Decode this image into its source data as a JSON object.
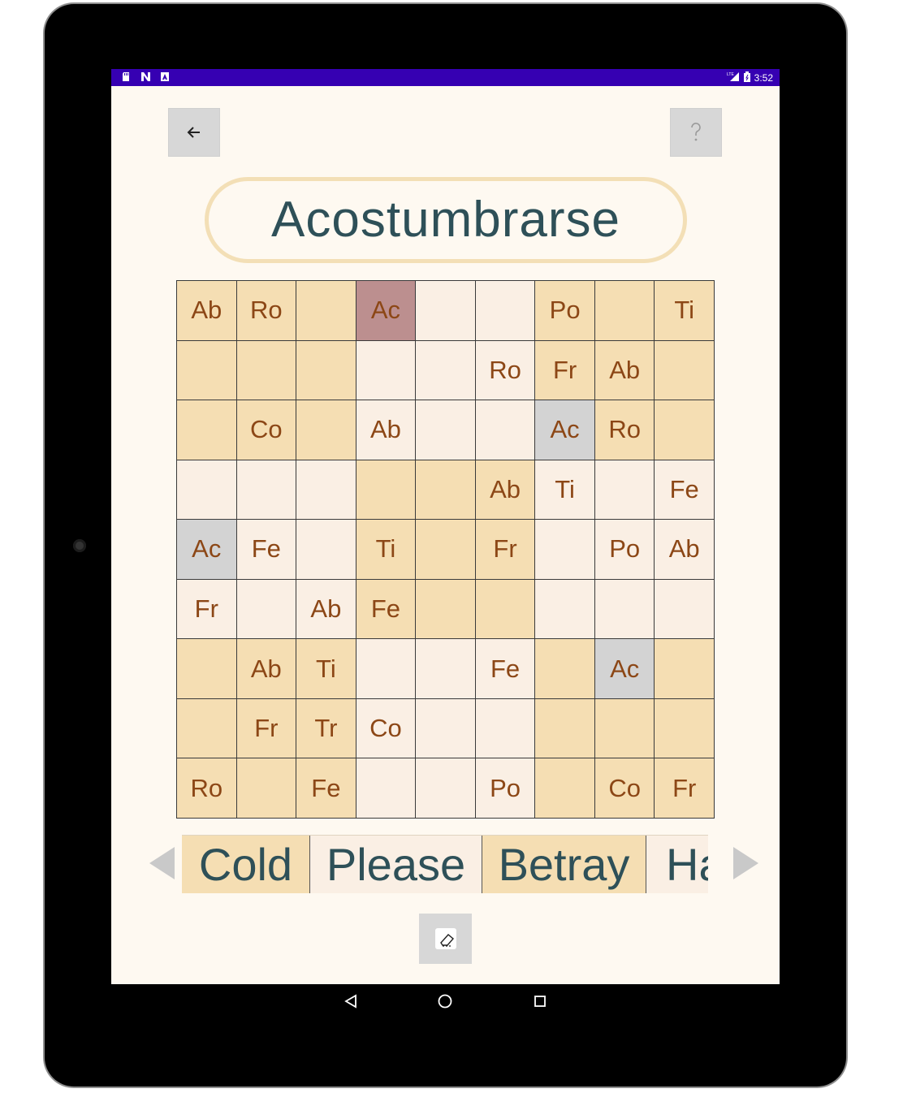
{
  "status_bar": {
    "time": "3:52",
    "signal_label": "LTE"
  },
  "header": {
    "back_icon": "arrow-left-icon",
    "help_icon": "question-mark-icon"
  },
  "target_word": "Acostumbrarse",
  "grid": {
    "rows": [
      [
        {
          "text": "Ab",
          "state": "t"
        },
        {
          "text": "Ro",
          "state": "t"
        },
        {
          "text": "",
          "state": "t"
        },
        {
          "text": "Ac",
          "state": "r"
        },
        {
          "text": "",
          "state": "l"
        },
        {
          "text": "",
          "state": "l"
        },
        {
          "text": "Po",
          "state": "t"
        },
        {
          "text": "",
          "state": "t"
        },
        {
          "text": "Ti",
          "state": "t"
        }
      ],
      [
        {
          "text": "",
          "state": "t"
        },
        {
          "text": "",
          "state": "t"
        },
        {
          "text": "",
          "state": "t"
        },
        {
          "text": "",
          "state": "l"
        },
        {
          "text": "",
          "state": "l"
        },
        {
          "text": "Ro",
          "state": "l"
        },
        {
          "text": "Fr",
          "state": "t"
        },
        {
          "text": "Ab",
          "state": "t"
        },
        {
          "text": "",
          "state": "t"
        }
      ],
      [
        {
          "text": "",
          "state": "t"
        },
        {
          "text": "Co",
          "state": "t"
        },
        {
          "text": "",
          "state": "t"
        },
        {
          "text": "Ab",
          "state": "l"
        },
        {
          "text": "",
          "state": "l"
        },
        {
          "text": "",
          "state": "l"
        },
        {
          "text": "Ac",
          "state": "g"
        },
        {
          "text": "Ro",
          "state": "t"
        },
        {
          "text": "",
          "state": "t"
        }
      ],
      [
        {
          "text": "",
          "state": "l"
        },
        {
          "text": "",
          "state": "l"
        },
        {
          "text": "",
          "state": "l"
        },
        {
          "text": "",
          "state": "t"
        },
        {
          "text": "",
          "state": "t"
        },
        {
          "text": "Ab",
          "state": "t"
        },
        {
          "text": "Ti",
          "state": "l"
        },
        {
          "text": "",
          "state": "l"
        },
        {
          "text": "Fe",
          "state": "l"
        }
      ],
      [
        {
          "text": "Ac",
          "state": "g"
        },
        {
          "text": "Fe",
          "state": "l"
        },
        {
          "text": "",
          "state": "l"
        },
        {
          "text": "Ti",
          "state": "t"
        },
        {
          "text": "",
          "state": "t"
        },
        {
          "text": "Fr",
          "state": "t"
        },
        {
          "text": "",
          "state": "l"
        },
        {
          "text": "Po",
          "state": "l"
        },
        {
          "text": "Ab",
          "state": "l"
        }
      ],
      [
        {
          "text": "Fr",
          "state": "l"
        },
        {
          "text": "",
          "state": "l"
        },
        {
          "text": "Ab",
          "state": "l"
        },
        {
          "text": "Fe",
          "state": "t"
        },
        {
          "text": "",
          "state": "t"
        },
        {
          "text": "",
          "state": "t"
        },
        {
          "text": "",
          "state": "l"
        },
        {
          "text": "",
          "state": "l"
        },
        {
          "text": "",
          "state": "l"
        }
      ],
      [
        {
          "text": "",
          "state": "t"
        },
        {
          "text": "Ab",
          "state": "t"
        },
        {
          "text": "Ti",
          "state": "t"
        },
        {
          "text": "",
          "state": "l"
        },
        {
          "text": "",
          "state": "l"
        },
        {
          "text": "Fe",
          "state": "l"
        },
        {
          "text": "",
          "state": "t"
        },
        {
          "text": "Ac",
          "state": "g"
        },
        {
          "text": "",
          "state": "t"
        }
      ],
      [
        {
          "text": "",
          "state": "t"
        },
        {
          "text": "Fr",
          "state": "t"
        },
        {
          "text": "Tr",
          "state": "t"
        },
        {
          "text": "Co",
          "state": "l"
        },
        {
          "text": "",
          "state": "l"
        },
        {
          "text": "",
          "state": "l"
        },
        {
          "text": "",
          "state": "t"
        },
        {
          "text": "",
          "state": "t"
        },
        {
          "text": "",
          "state": "t"
        }
      ],
      [
        {
          "text": "Ro",
          "state": "t"
        },
        {
          "text": "",
          "state": "t"
        },
        {
          "text": "Fe",
          "state": "t"
        },
        {
          "text": "",
          "state": "l"
        },
        {
          "text": "",
          "state": "l"
        },
        {
          "text": "Po",
          "state": "l"
        },
        {
          "text": "",
          "state": "t"
        },
        {
          "text": "Co",
          "state": "t"
        },
        {
          "text": "Fr",
          "state": "t"
        }
      ]
    ]
  },
  "word_options": [
    {
      "text": "Cold",
      "style": "t"
    },
    {
      "text": "Please",
      "style": "l"
    },
    {
      "text": "Betray",
      "style": "t"
    },
    {
      "text": "Ha",
      "style": "l"
    }
  ],
  "footer": {
    "eraser_icon": "eraser-icon"
  },
  "nav_bar": {
    "back_icon": "nav-back-icon",
    "home_icon": "nav-home-icon",
    "recents_icon": "nav-recents-icon"
  },
  "colors": {
    "status_bar": "#3600b2",
    "screen_bg": "#fef9f1",
    "cell_tan": "#f5deb3",
    "cell_light": "#faefe4",
    "cell_gray": "#d3d3d3",
    "cell_rose": "#bc8f8f",
    "cell_text": "#8c4716",
    "word_text": "#2e5058",
    "pill_border": "#f3dfb6"
  }
}
